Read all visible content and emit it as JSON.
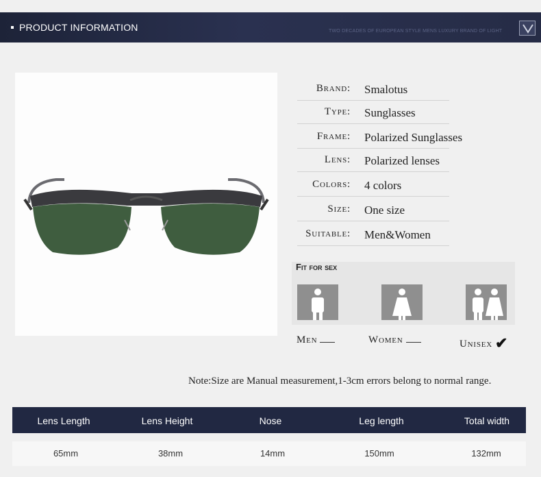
{
  "header": {
    "title": "PRODUCT INFORMATION",
    "tagline": "TWO DECADES OF EUROPEAN STYLE MENS LUXURY BRAND OF LIGHT"
  },
  "specs": [
    {
      "label": "Brand:",
      "value": "Smalotus"
    },
    {
      "label": "Type:",
      "value": "Sunglasses"
    },
    {
      "label": "Frame:",
      "value": "Polarized Sunglasses"
    },
    {
      "label": "Lens:",
      "value": "Polarized lenses"
    },
    {
      "label": "Colors:",
      "value": "4 colors"
    },
    {
      "label": "Size:",
      "value": "One size"
    },
    {
      "label": "Suitable:",
      "value": "Men&Women"
    }
  ],
  "fit": {
    "title": "Fit for sex",
    "options": [
      {
        "label": "Men",
        "icon": "man-icon",
        "checked": false
      },
      {
        "label": "Women",
        "icon": "woman-icon",
        "checked": false
      },
      {
        "label": "Unisex",
        "icon": "couple-icon",
        "checked": true
      }
    ],
    "check_glyph": "✔"
  },
  "note": "Note:Size are Manual measurement,1-3cm errors belong to normal range.",
  "table": {
    "headers": [
      "Lens Length",
      "Lens Height",
      "Nose",
      "Leg length",
      "Total width"
    ],
    "values": [
      "65mm",
      "38mm",
      "14mm",
      "150mm",
      "132mm"
    ]
  },
  "colors": {
    "header_bg": "#212842",
    "page_bg": "#f0f0f0",
    "lens": "#3d5a3c"
  }
}
